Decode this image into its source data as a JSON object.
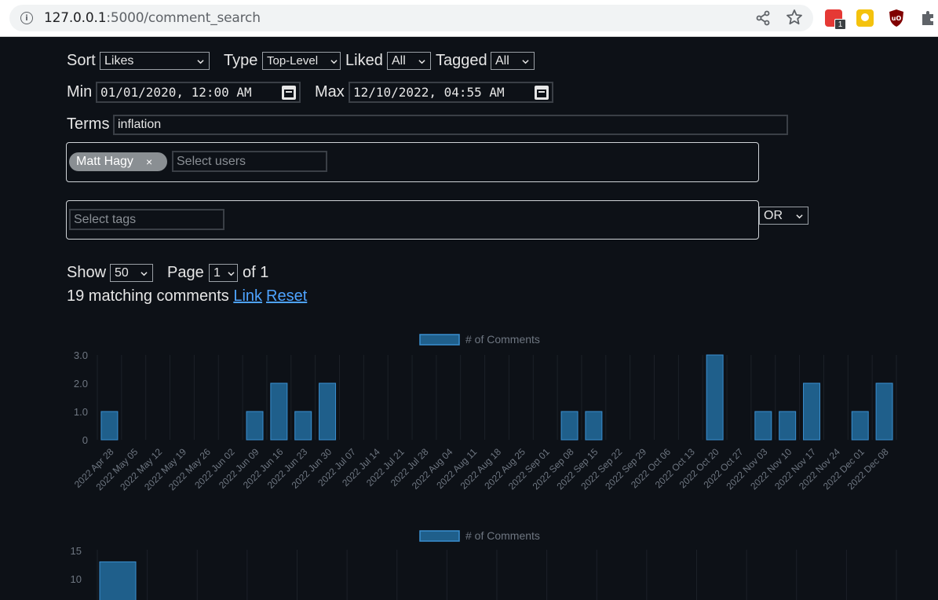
{
  "browser": {
    "url_host": "127.0.0.1",
    "url_path": ":5000/comment_search",
    "ext_badge": "1"
  },
  "filters": {
    "sort_label": "Sort",
    "sort_value": "Likes",
    "type_label": "Type",
    "type_value": "Top-Level",
    "liked_label": "Liked",
    "liked_value": "All",
    "tagged_label": "Tagged",
    "tagged_value": "All",
    "min_label": "Min",
    "min_value": "01/01/2020, 12:00 AM",
    "max_label": "Max",
    "max_value": "12/10/2022, 04:55 AM",
    "terms_label": "Terms",
    "terms_value": "inflation",
    "user_chip": "Matt Hagy",
    "user_chip_remove": "×",
    "users_placeholder": "Select users",
    "tags_placeholder": "Select tags",
    "tags_mode": "OR"
  },
  "pagination": {
    "show_label": "Show",
    "show_value": "50",
    "page_label": "Page",
    "page_value": "1",
    "of_text": "of 1"
  },
  "results": {
    "count_text": "19 matching comments",
    "link_label": "Link",
    "reset_label": "Reset"
  },
  "chart_data": [
    {
      "type": "bar",
      "legend": "# of Comments",
      "categories": [
        "2022 Apr 28",
        "2022 May 05",
        "2022 May 12",
        "2022 May 19",
        "2022 May 26",
        "2022 Jun 02",
        "2022 Jun 09",
        "2022 Jun 16",
        "2022 Jun 23",
        "2022 Jun 30",
        "2022 Jul 07",
        "2022 Jul 14",
        "2022 Jul 21",
        "2022 Jul 28",
        "2022 Aug 04",
        "2022 Aug 11",
        "2022 Aug 18",
        "2022 Aug 25",
        "2022 Sep 01",
        "2022 Sep 08",
        "2022 Sep 15",
        "2022 Sep 22",
        "2022 Sep 29",
        "2022 Oct 06",
        "2022 Oct 13",
        "2022 Oct 20",
        "2022 Oct 27",
        "2022 Nov 03",
        "2022 Nov 10",
        "2022 Nov 17",
        "2022 Nov 24",
        "2022 Dec 01",
        "2022 Dec 08"
      ],
      "values": [
        1,
        0,
        0,
        0,
        0,
        0,
        1,
        2,
        1,
        2,
        0,
        0,
        0,
        0,
        0,
        0,
        0,
        0,
        0,
        1,
        1,
        0,
        0,
        0,
        0,
        3,
        0,
        1,
        1,
        2,
        0,
        1,
        2
      ],
      "yticks": [
        "0",
        "1.0",
        "2.0",
        "3.0"
      ],
      "ylim": [
        0,
        3
      ],
      "color": "#1f5f8b"
    },
    {
      "type": "bar",
      "legend": "# of Comments",
      "yticks": [
        "10",
        "15"
      ],
      "visible_values": [
        13
      ],
      "color": "#1f5f8b"
    }
  ]
}
